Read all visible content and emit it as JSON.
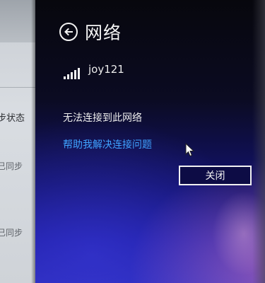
{
  "background_window": {
    "rows": [
      {
        "text": "步状态",
        "style": "label"
      },
      {
        "text": "已同步",
        "style": "sub"
      },
      {
        "text": "已同步",
        "style": "sub"
      }
    ]
  },
  "panel": {
    "title": "网络",
    "network": {
      "name": "joy121",
      "signal_bars": 5
    },
    "status_text": "无法连接到此网络",
    "help_link": "帮助我解决连接问题",
    "close_button": "关闭"
  },
  "icons": {
    "back": "back-arrow-icon",
    "signal": "wifi-signal-icon",
    "cursor": "mouse-cursor-icon"
  },
  "colors": {
    "link": "#3fa2ff",
    "text": "#f4f4f4",
    "panel_dark": "#07070d",
    "panel_blue": "#1d1ca3"
  }
}
